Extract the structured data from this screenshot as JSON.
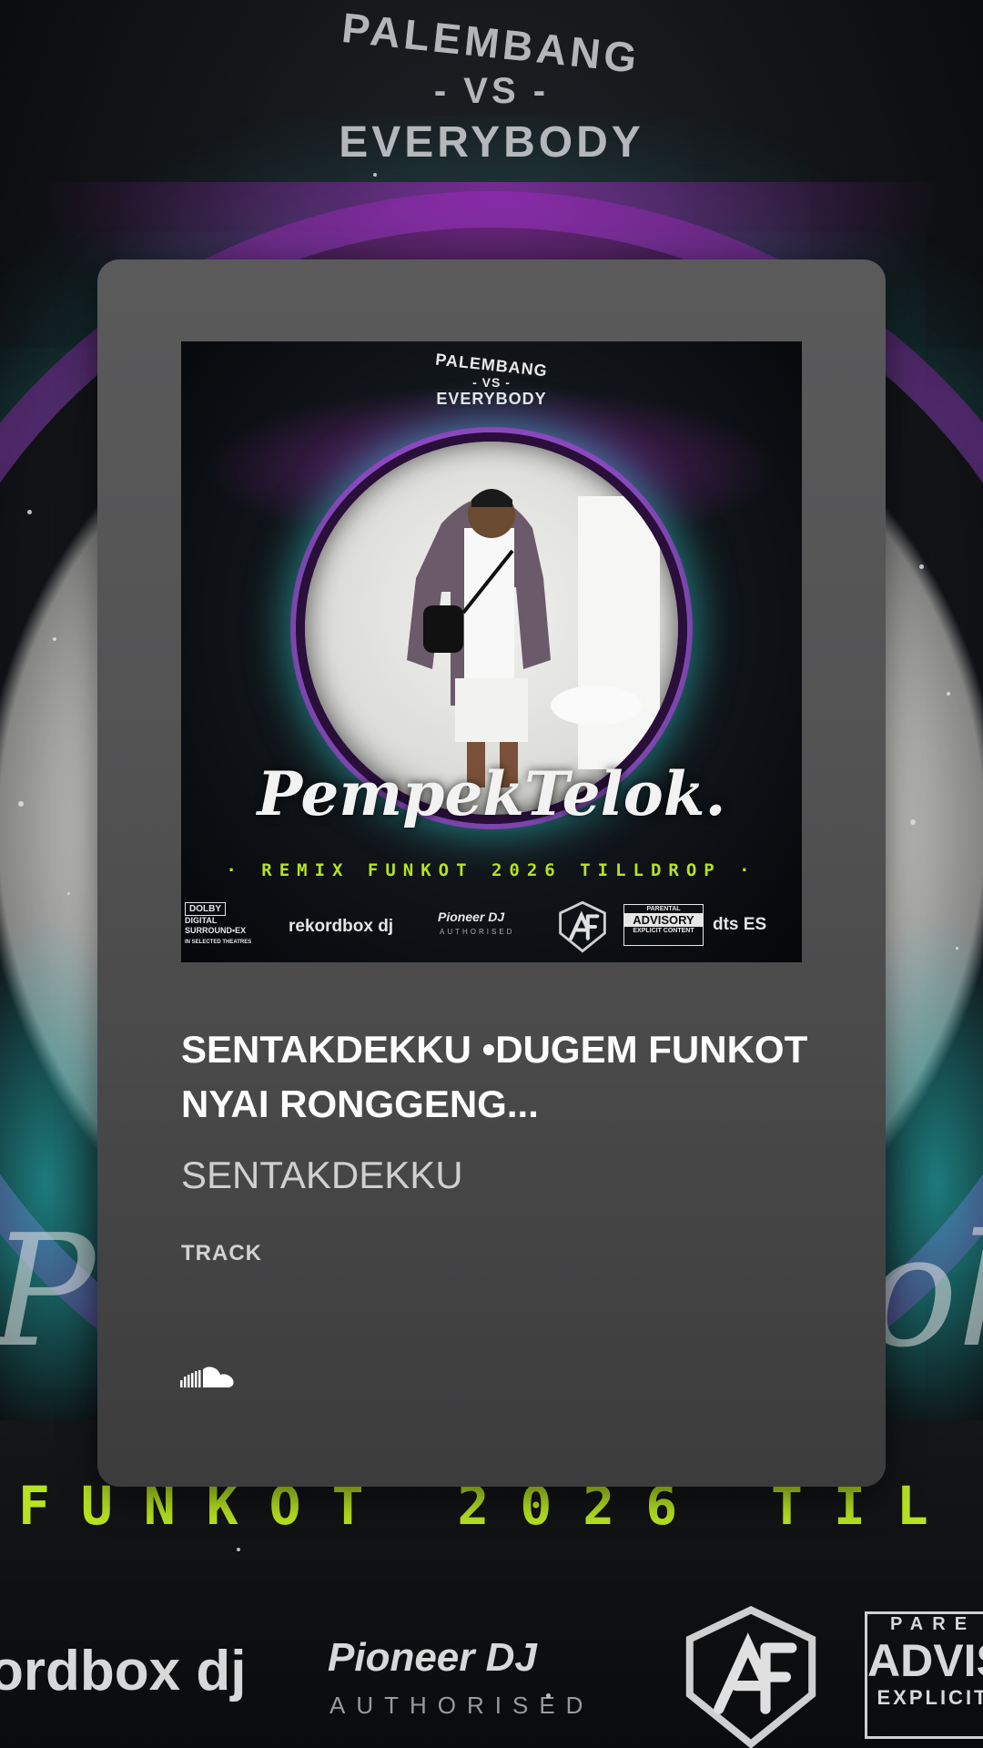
{
  "background": {
    "header": {
      "line1": "PALEMBANG",
      "line2": "- VS -",
      "line3": "EVERYBODY"
    },
    "script_left": "P",
    "script_right": "ok",
    "funkot_text": "FUNKOT 2026 TIL",
    "logos": {
      "rekordbox": "ordbox dj",
      "pioneer": "Pioneer DJ",
      "pioneer_sub": "AUTHORISED",
      "advisory_top": "PARE",
      "advisory_mid": "ADVIS",
      "advisory_bottom": "EXPLICIT"
    }
  },
  "card": {
    "artwork": {
      "top_line1": "PALEMBANG",
      "top_line2": "- VS -",
      "top_line3": "EVERYBODY",
      "script": "PempekTelok.",
      "remix_line": "· REMIX FUNKOT 2026 TILLDROP ·",
      "logos": {
        "dolby_box": "DOLBY",
        "dolby_lines": "DIGITAL SURROUND•EX",
        "dolby_small": "IN SELECTED THEATRES",
        "rekordbox": "rekordbox dj",
        "pioneer": "Pioneer DJ",
        "pioneer_sub": "AUTHORISED",
        "advisory_top": "PARENTAL",
        "advisory_mid": "ADVISORY",
        "advisory_bottom": "EXPLICIT CONTENT",
        "dts": "dts ES"
      }
    },
    "title": "SENTAKDEKKU •DUGEM FUNKOT NYAI RONGGENG...",
    "artist": "SENTAKDEKKU",
    "type": "TRACK",
    "source_icon": "soundcloud-icon"
  },
  "colors": {
    "accent_green": "#b7e31f",
    "card_bg": "#535354",
    "purple_glow": "#b928dc",
    "teal_glow": "#28d2d2"
  }
}
